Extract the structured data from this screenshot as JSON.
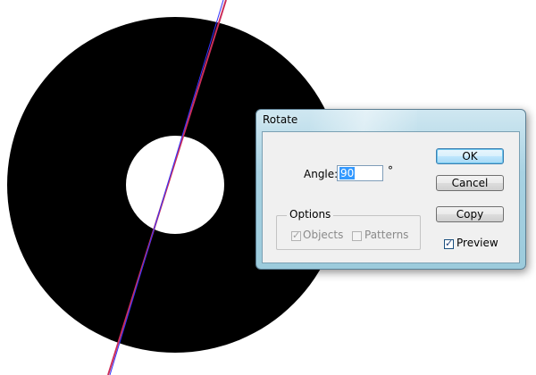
{
  "dialog": {
    "title": "Rotate",
    "angle": {
      "label": "Angle:",
      "value": "90",
      "unit": "°"
    },
    "options": {
      "legend": "Options",
      "objects": {
        "label": "Objects",
        "checked": true,
        "enabled": false
      },
      "patterns": {
        "label": "Patterns",
        "checked": false,
        "enabled": false
      }
    },
    "buttons": {
      "ok": "OK",
      "cancel": "Cancel",
      "copy": "Copy"
    },
    "preview": {
      "label": "Preview",
      "checked": true
    }
  },
  "artwork": {
    "shape_color": "#000000",
    "guide_line_color": "#cc2e5a",
    "preview_line_color": "#3333ff"
  }
}
